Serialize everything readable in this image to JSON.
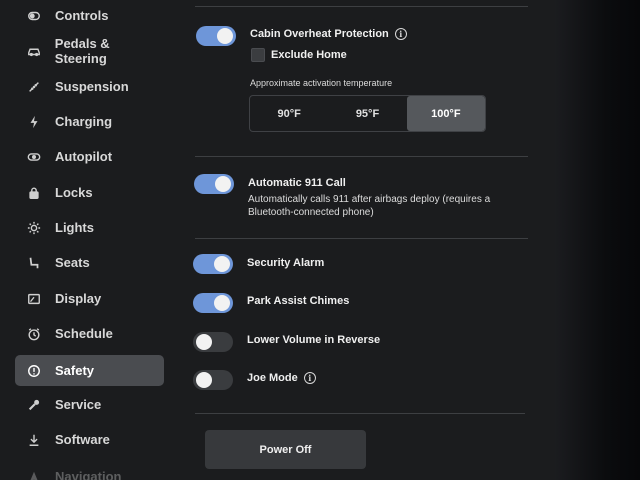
{
  "sidebar": {
    "items": [
      {
        "label": "Controls",
        "icon": "toggle-icon"
      },
      {
        "label": "Pedals & Steering",
        "icon": "car-icon"
      },
      {
        "label": "Suspension",
        "icon": "suspension-icon"
      },
      {
        "label": "Charging",
        "icon": "lightning-icon"
      },
      {
        "label": "Autopilot",
        "icon": "steering-wheel-icon"
      },
      {
        "label": "Locks",
        "icon": "lock-icon"
      },
      {
        "label": "Lights",
        "icon": "sun-icon"
      },
      {
        "label": "Seats",
        "icon": "seat-icon"
      },
      {
        "label": "Display",
        "icon": "display-icon"
      },
      {
        "label": "Schedule",
        "icon": "clock-icon"
      },
      {
        "label": "Safety",
        "icon": "alert-circle-icon",
        "active": true
      },
      {
        "label": "Service",
        "icon": "wrench-icon"
      },
      {
        "label": "Software",
        "icon": "download-icon"
      },
      {
        "label": "Navigation",
        "icon": "navigation-icon"
      }
    ]
  },
  "cabin": {
    "title": "Cabin Overheat Protection",
    "on": true,
    "exclude_home_label": "Exclude Home",
    "exclude_home_checked": false,
    "temp_label": "Approximate activation temperature",
    "temps": [
      "90°F",
      "95°F",
      "100°F"
    ],
    "selected_temp": "100°F"
  },
  "call911": {
    "title": "Automatic 911 Call",
    "desc": "Automatically calls 911 after airbags deploy (requires a Bluetooth-connected phone)",
    "on": true
  },
  "security_alarm": {
    "title": "Security Alarm",
    "on": true
  },
  "park_assist": {
    "title": "Park Assist Chimes",
    "on": true
  },
  "lower_volume": {
    "title": "Lower Volume in Reverse",
    "on": false
  },
  "joe_mode": {
    "title": "Joe Mode",
    "on": false
  },
  "power_off_label": "Power Off",
  "colors": {
    "accent": "#6e96d9",
    "active_bg": "#4a4c50"
  }
}
